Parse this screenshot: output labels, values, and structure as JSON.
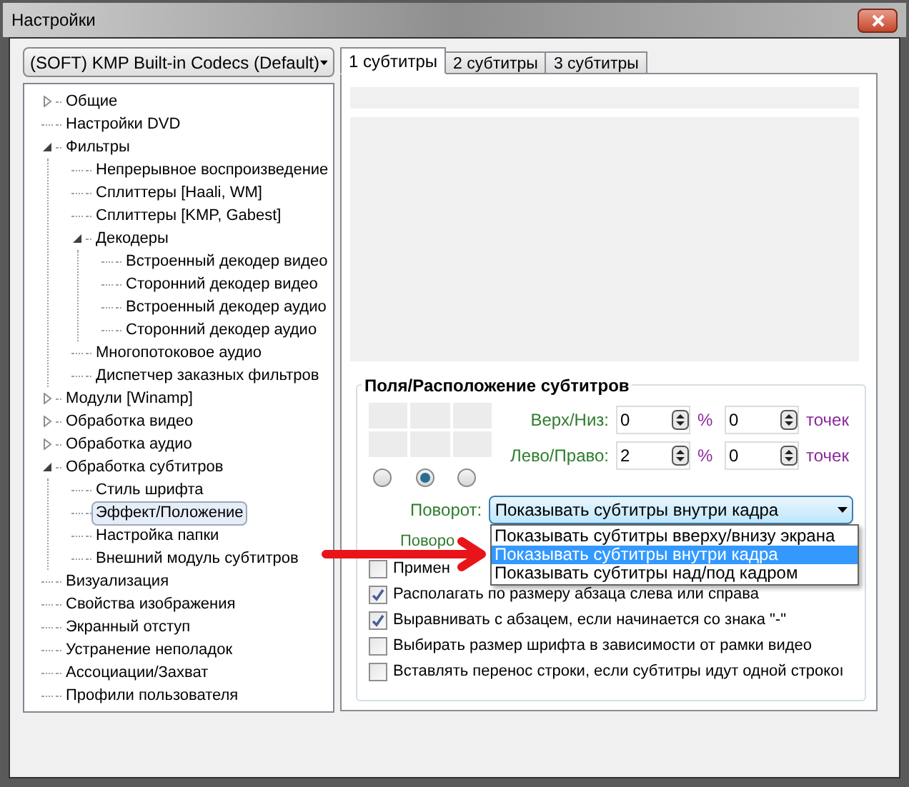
{
  "window": {
    "title": "Настройки"
  },
  "codec_select": {
    "value": "(SOFT) KMP Built-in Codecs (Default)"
  },
  "tree": [
    {
      "label": "Общие",
      "expanded": false,
      "selected": false
    },
    {
      "label": "Настройки DVD",
      "selected": false
    },
    {
      "label": "Фильтры",
      "expanded": true,
      "selected": false,
      "children": [
        {
          "label": "Непрерывное воспроизведение",
          "selected": false
        },
        {
          "label": "Сплиттеры [Haali, WM]",
          "selected": false
        },
        {
          "label": "Сплиттеры [KMP, Gabest]",
          "selected": false
        },
        {
          "label": "Декодеры",
          "expanded": true,
          "selected": false,
          "children": [
            {
              "label": "Встроенный декодер видео",
              "selected": false
            },
            {
              "label": "Сторонний декодер видео",
              "selected": false
            },
            {
              "label": "Встроенный декодер аудио",
              "selected": false
            },
            {
              "label": "Сторонний декодер аудио",
              "selected": false
            }
          ]
        },
        {
          "label": "Многопотоковое аудио",
          "selected": false
        },
        {
          "label": "Диспетчер заказных фильтров",
          "selected": false
        }
      ]
    },
    {
      "label": "Модули [Winamp]",
      "expanded": false,
      "selected": false
    },
    {
      "label": "Обработка видео",
      "expanded": false,
      "selected": false
    },
    {
      "label": "Обработка аудио",
      "expanded": false,
      "selected": false
    },
    {
      "label": "Обработка субтитров",
      "expanded": true,
      "selected": false,
      "children": [
        {
          "label": "Стиль шрифта",
          "selected": false
        },
        {
          "label": "Эффект/Положение",
          "selected": true
        },
        {
          "label": "Настройка папки",
          "selected": false
        },
        {
          "label": "Внешний модуль субтитров",
          "selected": false
        }
      ]
    },
    {
      "label": "Визуализация",
      "selected": false
    },
    {
      "label": "Свойства изображения",
      "selected": false
    },
    {
      "label": "Экранный отступ",
      "selected": false
    },
    {
      "label": "Устранение неполадок",
      "selected": false
    },
    {
      "label": "Ассоциации/Захват",
      "selected": false
    },
    {
      "label": "Профили пользователя",
      "selected": false
    }
  ],
  "tabs": [
    {
      "label": "1 субтитры",
      "selected": true
    },
    {
      "label": "2 субтитры",
      "selected": false
    },
    {
      "label": "3 субтитры",
      "selected": false
    }
  ],
  "group": {
    "title": "Поля/Расположение субтитров",
    "position_radios": [
      {
        "selected": false
      },
      {
        "selected": true
      },
      {
        "selected": false
      }
    ],
    "margins": [
      {
        "label": "Верх/Низ:",
        "percent": "0",
        "percent_unit": "%",
        "pixels": "0",
        "pixels_unit": "точек"
      },
      {
        "label": "Лево/Право:",
        "percent": "2",
        "percent_unit": "%",
        "pixels": "0",
        "pixels_unit": "точек"
      }
    ],
    "rotation": {
      "label": "Поворот:",
      "value": "Показывать субтитры внутри кадра",
      "options": [
        {
          "label": "Показывать субтитры вверху/внизу экрана",
          "selected": false
        },
        {
          "label": "Показывать субтитры внутри кадра",
          "selected": true
        },
        {
          "label": "Показывать субтитры над/под кадром",
          "selected": false
        }
      ]
    },
    "covered_label": "Поворо",
    "checkboxes": [
      {
        "label": "Примен",
        "checked": false
      },
      {
        "label": "Располагать по размеру абзаца слева или справа",
        "checked": true
      },
      {
        "label": "Выравнивать с абзацем, если начинается со знака \"-\"",
        "checked": true
      },
      {
        "label": "Выбирать размер шрифта в зависимости от рамки видео",
        "checked": false
      },
      {
        "label": "Вставлять перенос строки, если субтитры идут одной строкоı",
        "checked": false
      }
    ]
  }
}
